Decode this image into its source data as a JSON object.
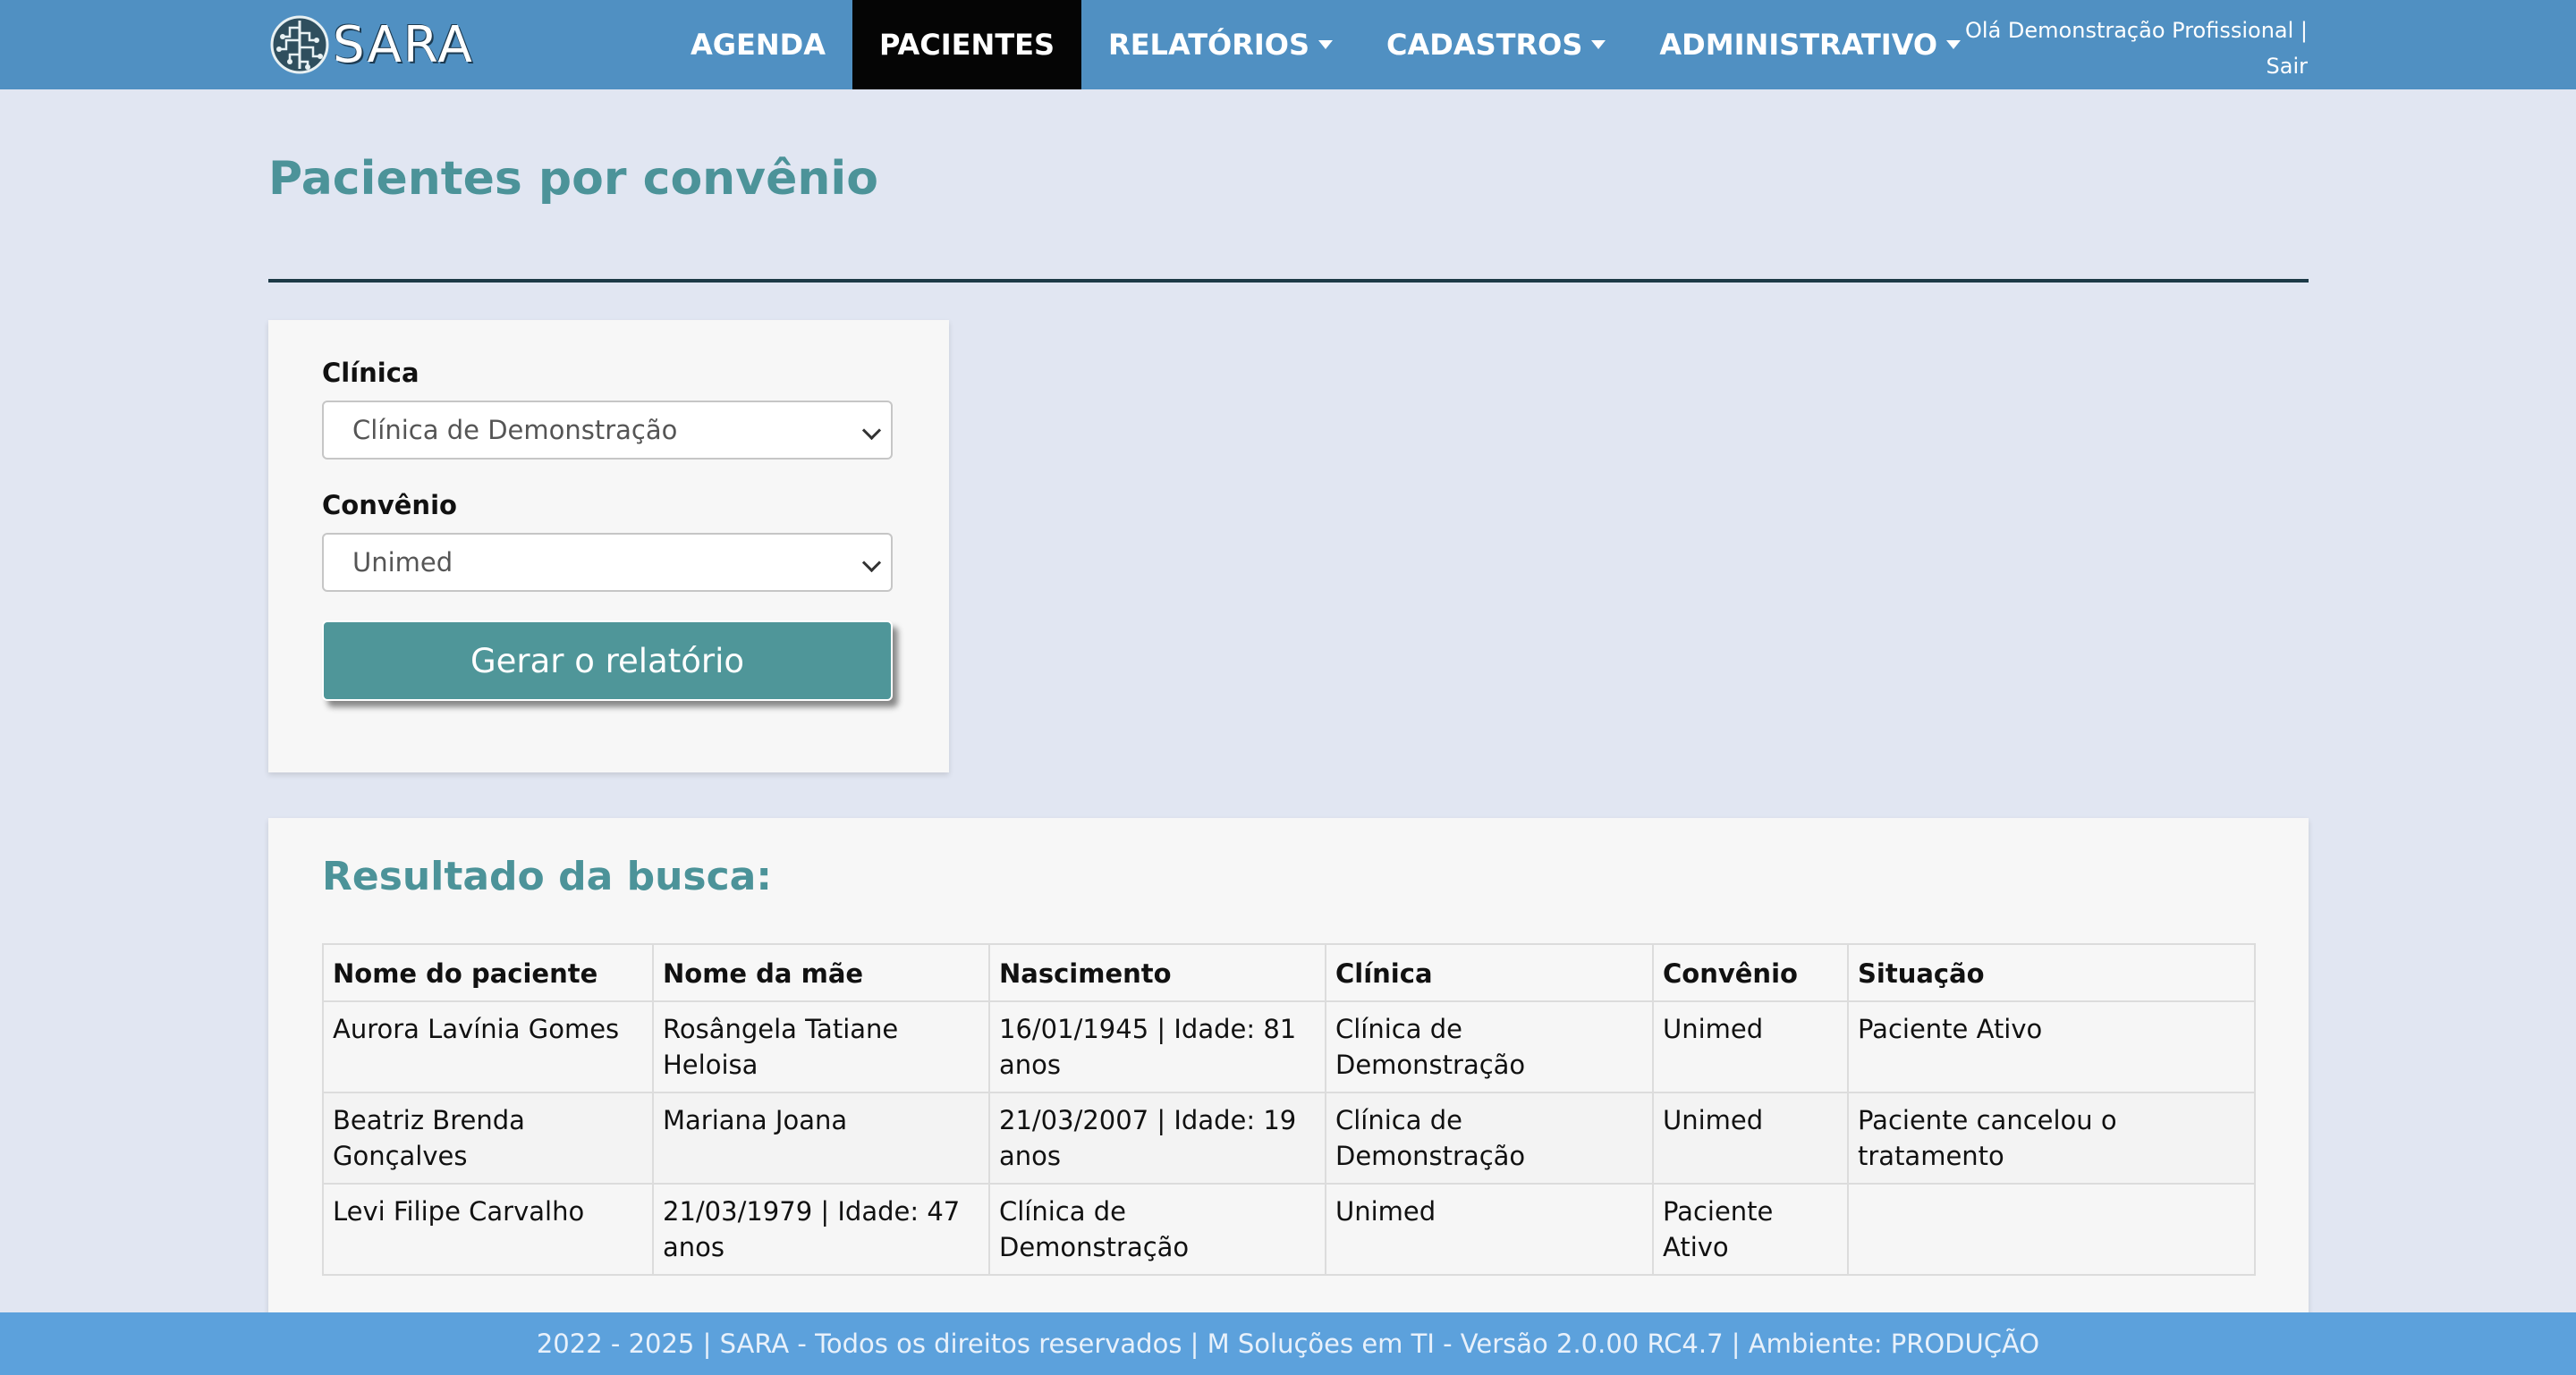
{
  "app": {
    "brand": "SARA"
  },
  "nav": {
    "items": [
      {
        "label": "AGENDA",
        "dropdown": false
      },
      {
        "label": "PACIENTES",
        "dropdown": false,
        "active": true
      },
      {
        "label": "RELATÓRIOS",
        "dropdown": true
      },
      {
        "label": "CADASTROS",
        "dropdown": true
      },
      {
        "label": "ADMINISTRATIVO",
        "dropdown": true
      }
    ],
    "greeting": "Olá Demonstração Profissional |",
    "logout": "Sair"
  },
  "page": {
    "title": "Pacientes por convênio"
  },
  "filters": {
    "clinic_label": "Clínica",
    "clinic_value": "Clínica de Demonstração",
    "insurance_label": "Convênio",
    "insurance_value": "Unimed",
    "generate_label": "Gerar o relatório"
  },
  "results": {
    "title": "Resultado da busca:",
    "columns": [
      "Nome do paciente",
      "Nome da mãe",
      "Nascimento",
      "Clínica",
      "Convênio",
      "Situação"
    ],
    "rows": [
      [
        "Aurora Lavínia Gomes",
        "Rosângela Tatiane Heloisa",
        "16/01/1945 | Idade: 81 anos",
        "Clínica de Demonstração",
        "Unimed",
        "Paciente Ativo"
      ],
      [
        "Beatriz Brenda Gonçalves",
        "Mariana Joana",
        "21/03/2007 | Idade: 19 anos",
        "Clínica de Demonstração",
        "Unimed",
        "Paciente cancelou o tratamento"
      ],
      [
        "Levi Filipe Carvalho",
        "21/03/1979 | Idade: 47 anos",
        "Clínica de Demonstração",
        "Unimed",
        "Paciente Ativo",
        ""
      ]
    ]
  },
  "footer": {
    "text": "2022 - 2025 | SARA - Todos os direitos reservados | M Soluções em TI - Versão 2.0.00 RC4.7 | Ambiente: PRODUÇÃO"
  },
  "colors": {
    "nav_bg": "#5090c2",
    "nav_active": "#050505",
    "accent": "#4c9399",
    "button": "#4f9699",
    "page_bg": "#e1e6f2",
    "footer_bg": "#5ca1dc"
  }
}
